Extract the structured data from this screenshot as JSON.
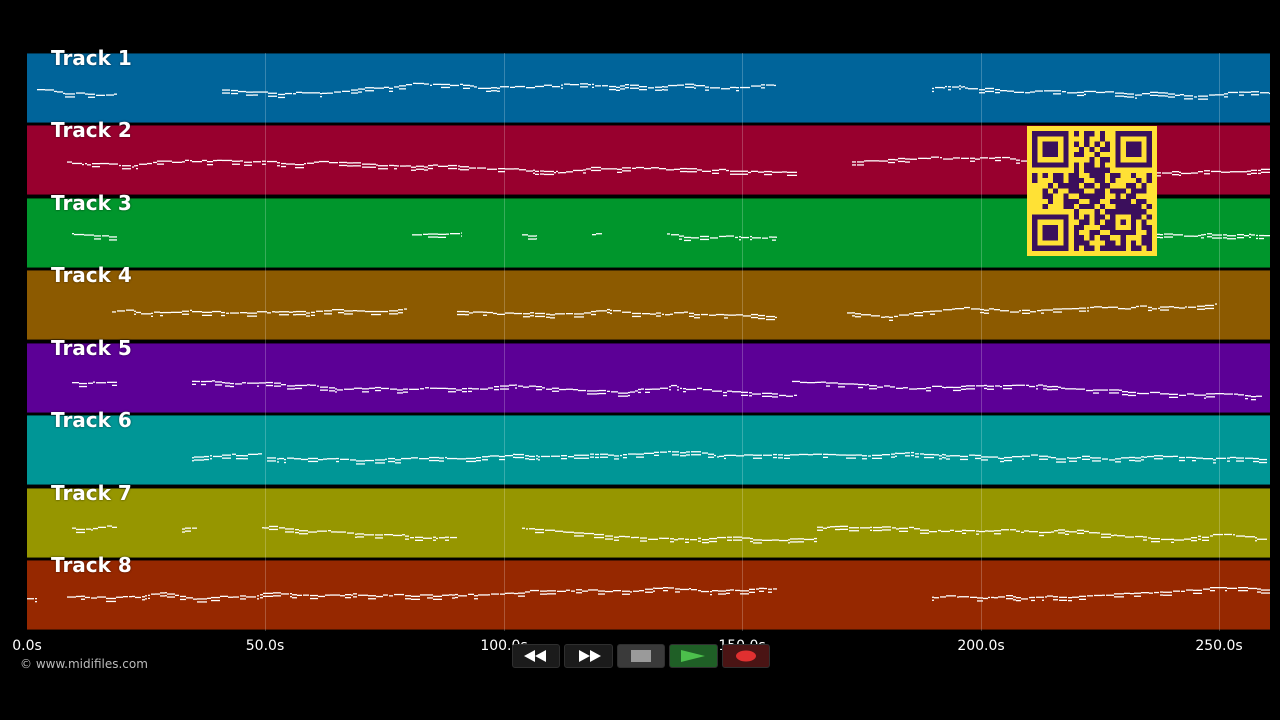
{
  "tracks": [
    {
      "label": "Track 1",
      "color": "#00649a"
    },
    {
      "label": "Track 2",
      "color": "#98002e"
    },
    {
      "label": "Track 3",
      "color": "#00962c"
    },
    {
      "label": "Track 4",
      "color": "#8c5a00"
    },
    {
      "label": "Track 5",
      "color": "#5c0096"
    },
    {
      "label": "Track 6",
      "color": "#009696"
    },
    {
      "label": "Track 7",
      "color": "#969600"
    },
    {
      "label": "Track 8",
      "color": "#962800"
    }
  ],
  "timeline": {
    "ticks": [
      "0.0s",
      "50.0s",
      "100.0s",
      "150.0s",
      "200.0s",
      "250.0s"
    ]
  },
  "copyright": "© www.midifiles.com",
  "transport": {
    "buttons": [
      {
        "name": "rewind",
        "icon": "rewind-icon"
      },
      {
        "name": "fast-forward",
        "icon": "fast-forward-icon"
      },
      {
        "name": "stop",
        "icon": "stop-icon"
      },
      {
        "name": "play",
        "icon": "play-icon",
        "color": "#4cc04c"
      },
      {
        "name": "record",
        "icon": "record-icon",
        "color": "#e03030"
      }
    ]
  },
  "qr_code": {
    "icon": "qr-code-icon",
    "fg": "#3b0f5c",
    "bg": "#ffe135"
  },
  "note_color": "#ffffff"
}
